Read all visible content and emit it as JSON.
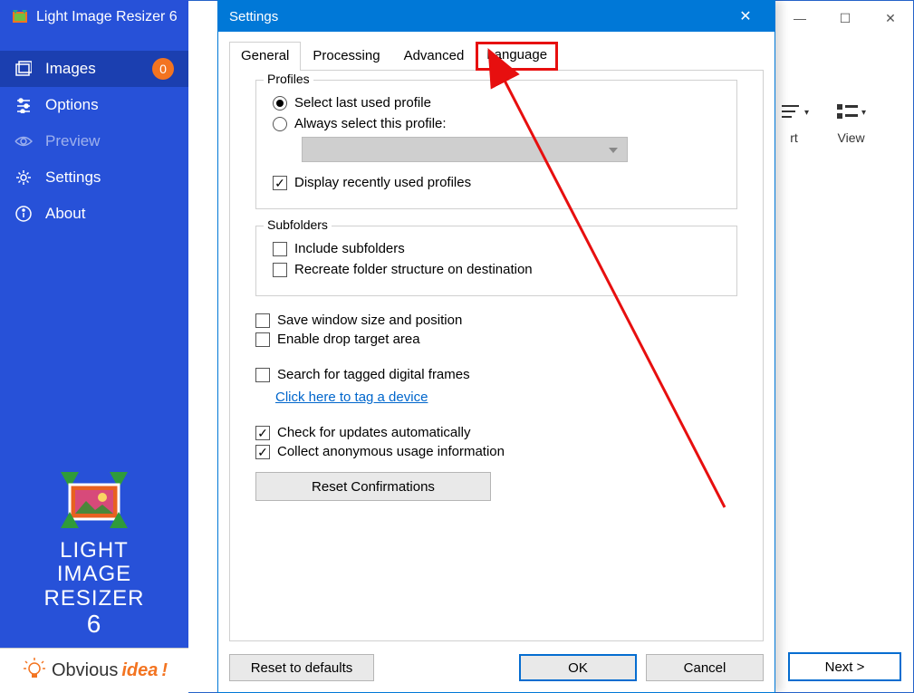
{
  "app": {
    "title": "Light Image Resizer 6"
  },
  "sidebar": {
    "items": [
      {
        "label": "Images",
        "badge": "0"
      },
      {
        "label": "Options"
      },
      {
        "label": "Preview"
      },
      {
        "label": "Settings"
      },
      {
        "label": "About"
      }
    ],
    "logo": {
      "line1": "LIGHT",
      "line2": "IMAGE",
      "line3": "RESIZER",
      "six": "6"
    },
    "footer": {
      "brand1": "Obvious",
      "brand2": "idea",
      "bang": "!"
    }
  },
  "toolbar_right": {
    "sort": "rt",
    "view": "View"
  },
  "next_button": "Next >",
  "dialog": {
    "title": "Settings",
    "tabs": {
      "general": "General",
      "processing": "Processing",
      "advanced": "Advanced",
      "language": "Language"
    },
    "profiles": {
      "legend": "Profiles",
      "opt_last": "Select last used profile",
      "opt_always": "Always select this profile:",
      "display_recent": "Display recently used profiles"
    },
    "subfolders": {
      "legend": "Subfolders",
      "include": "Include subfolders",
      "recreate": "Recreate folder structure on destination"
    },
    "save_pos": "Save window size and position",
    "drop_target": "Enable drop target area",
    "search_frames": "Search for tagged digital frames",
    "tag_link": "Click here to tag a device",
    "check_updates": "Check for updates automatically",
    "collect_usage": "Collect anonymous usage information",
    "reset_confirm": "Reset Confirmations",
    "reset_defaults": "Reset to defaults",
    "ok": "OK",
    "cancel": "Cancel"
  }
}
